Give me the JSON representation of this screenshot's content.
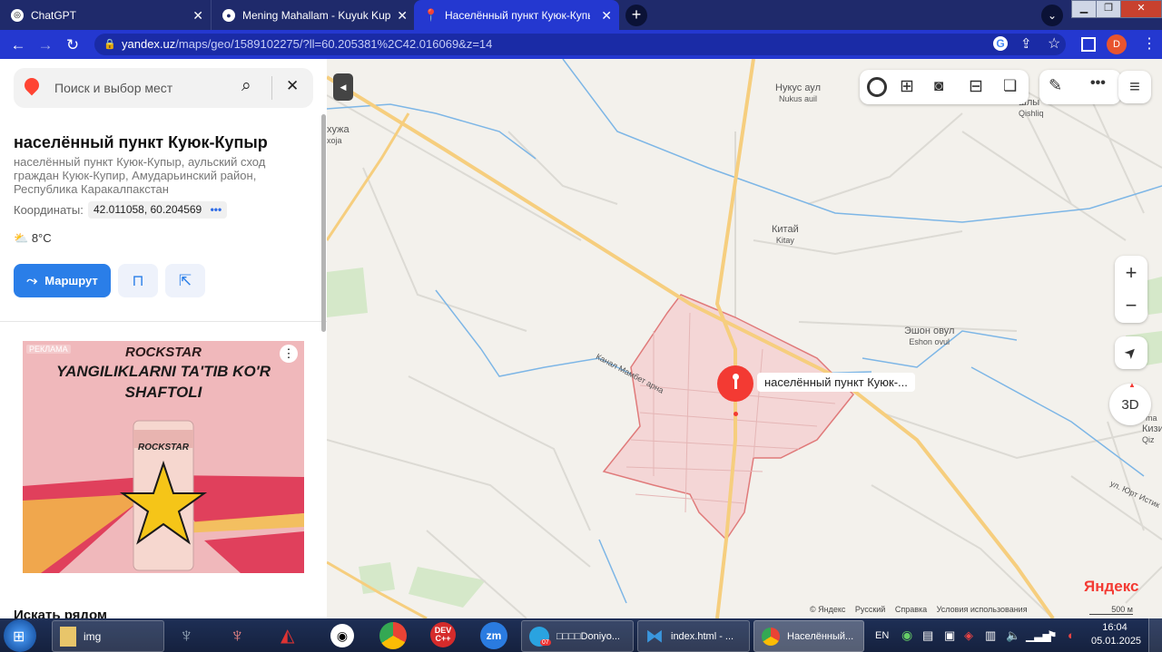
{
  "browser": {
    "tabs": [
      {
        "title": "ChatGPT",
        "active": false
      },
      {
        "title": "Mening Mahallam - Kuyuk Kupir",
        "active": false
      },
      {
        "title": "Населённый пункт Куюк-Купыр",
        "active": true
      }
    ],
    "url_host": "yandex.uz",
    "url_path": "/maps/geo/1589102275/?ll=60.205381%2C42.016069&z=14",
    "profile_initial": "D"
  },
  "sidebar": {
    "search_placeholder": "Поиск и выбор мест",
    "title": "населённый пункт Куюк-Купыр",
    "address": "населённый пункт Куюк-Купыр, аульский сход граждан Куюк-Купир, Амударьинский район, Республика Каракалпакстан",
    "coords_label": "Координаты:",
    "coords_value": "42.011058, 60.204569",
    "weather": "8°C",
    "route_label": "Маршрут",
    "ad": {
      "tag": "РЕКЛАМА",
      "brand": "ROCKSTAR",
      "headline_line1": "YANGILIKLARNI TA'TIB KO'R",
      "headline_line2": "SHAFTOLI"
    },
    "next_section": "Искать рядом"
  },
  "map": {
    "labels": [
      {
        "name": "Нукус аул",
        "sub": "Nukus auil"
      },
      {
        "name": "Китай",
        "sub": "Kitay"
      },
      {
        "name": "Эшон овул",
        "sub": "Eshon ovul"
      },
      {
        "name": "хужа",
        "sub": "xoja"
      },
      {
        "name": "шлы",
        "sub": "Qishliq"
      },
      {
        "name": "Кизи",
        "sub": "Qiz"
      },
      {
        "name": "ма",
        "sub": "ma"
      }
    ],
    "canal_label": "Канал Мамбет арна",
    "street_label": "ул. Юрт Истик",
    "place_label": "населённый пункт Куюк-...",
    "logo": "Яндекс",
    "footer": [
      "© Яндекс",
      "Русский",
      "Справка",
      "Условия использования"
    ],
    "scale": "500 м",
    "btn_3d": "3D"
  },
  "taskbar": {
    "items": [
      "img",
      "DEV C++",
      "zm",
      "□□□□Doniyo...",
      "index.html - ...",
      "Населённый..."
    ],
    "telegram_badge": "07",
    "lang": "EN",
    "time": "16:04",
    "date": "05.01.2025"
  }
}
